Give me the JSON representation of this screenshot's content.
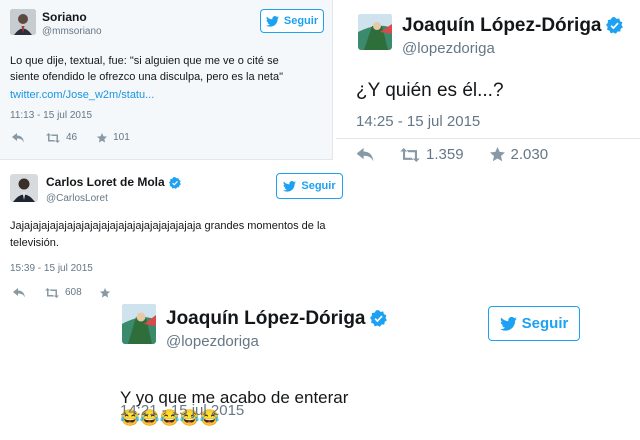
{
  "tweets": [
    {
      "name": "Soriano",
      "handle": "@mmsoriano",
      "follow": "Seguir",
      "text": "Lo que dije, textual, fue: \"si alguien que me ve o cité se siente ofendido le ofrezco una disculpa, pero es la neta\"",
      "link": "twitter.com/Jose_w2m/statu...",
      "time": "11:13 - 15 jul 2015",
      "retweets": "46",
      "likes": "101"
    },
    {
      "name": "Joaquín López-Dóriga",
      "handle": "@lopezdoriga",
      "text": "¿Y quién es él...?",
      "time": "14:25 - 15 jul 2015",
      "retweets": "1.359",
      "likes": "2.030"
    },
    {
      "name": "Carlos Loret de Mola",
      "handle": "@CarlosLoret",
      "follow": "Seguir",
      "text": "Jajajajajajajajajajajajajajajajajajajajajaja grandes momentos de la televisión.",
      "time": "15:39 - 15 jul 2015",
      "retweets": "608"
    },
    {
      "name": "Joaquín López-Dóriga",
      "handle": "@lopezdoriga",
      "follow": "Seguir",
      "text": "Y yo que me acabo de enterar",
      "emoji": "😂😂😂😂😂",
      "time": "14:21 - 15 jul 2015"
    }
  ],
  "colors": {
    "accent": "#1da1f2",
    "verified": "#1da1f2",
    "link": "#1b95e0",
    "muted": "#657786"
  }
}
